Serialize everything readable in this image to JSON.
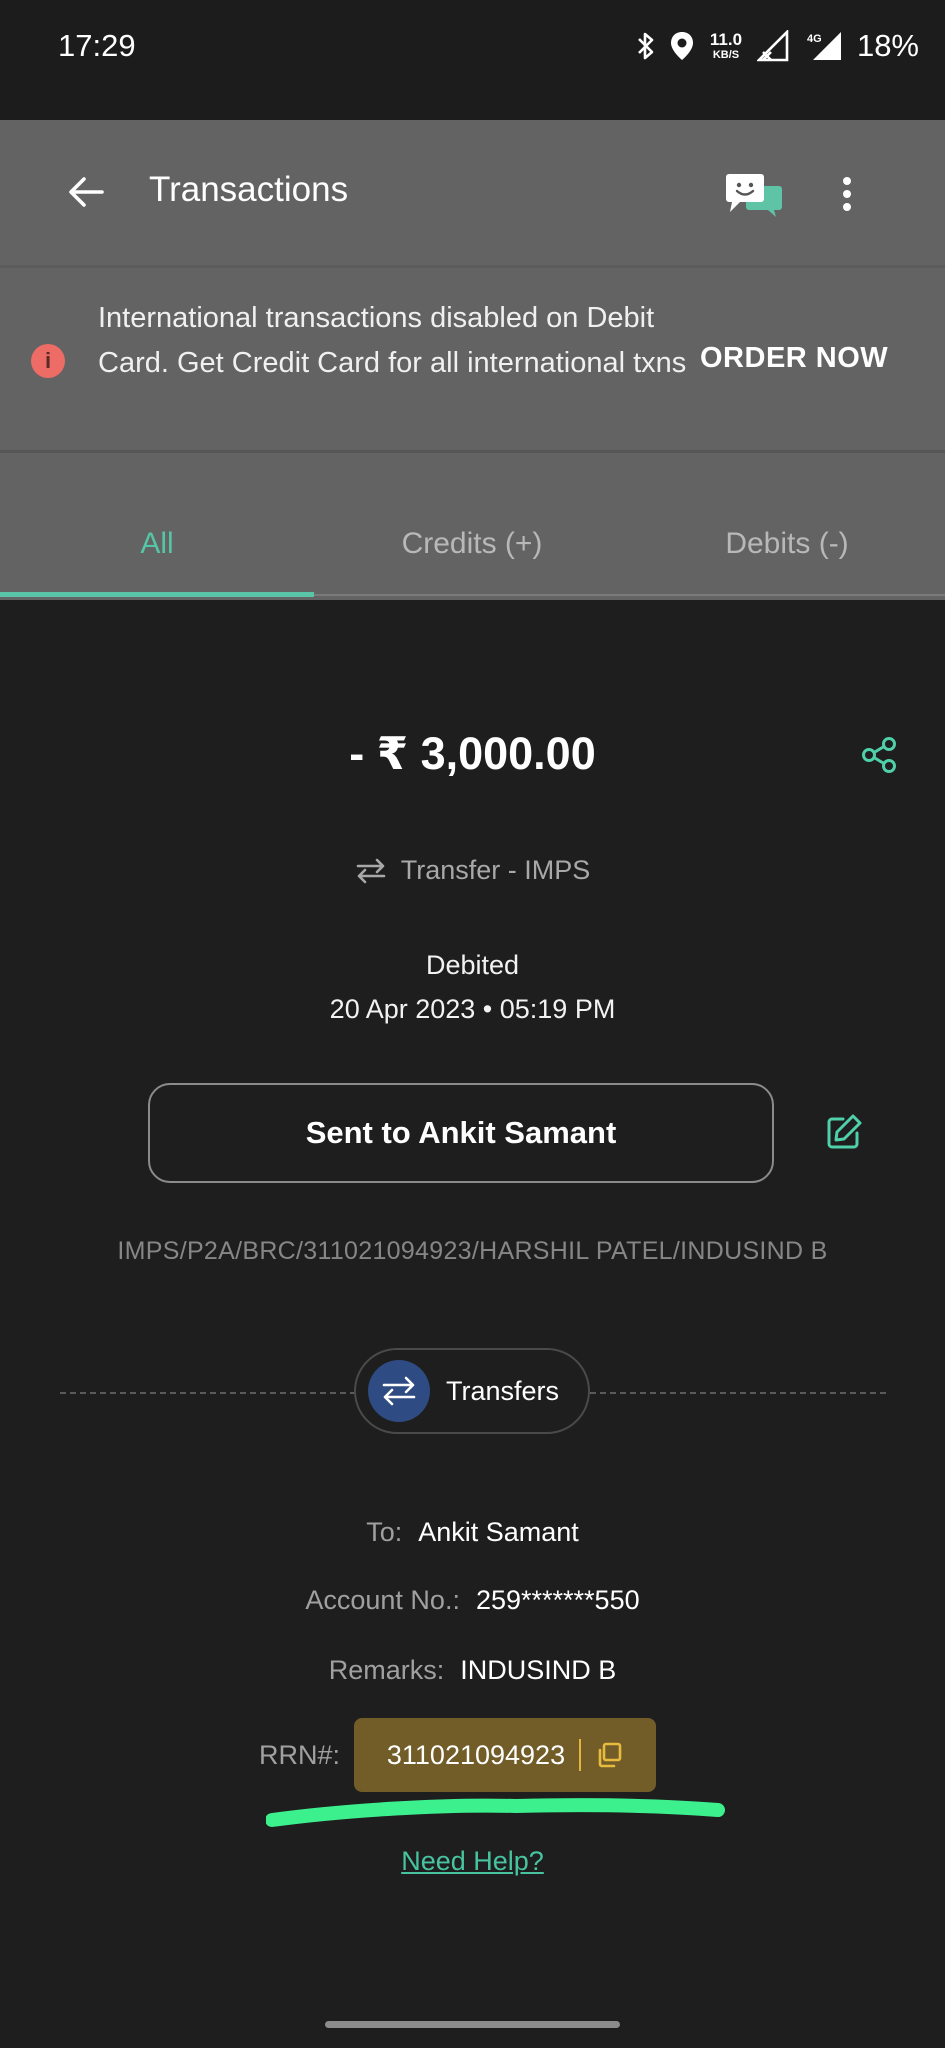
{
  "status_bar": {
    "time": "17:29",
    "net_speed_value": "11.0",
    "net_speed_unit": "KB/S",
    "network": "4G",
    "battery": "18%",
    "icons": [
      "bluetooth-icon",
      "location-icon",
      "signal-icon",
      "battery-icon"
    ]
  },
  "app_bar": {
    "title": "Transactions",
    "back_icon": "arrow-left-icon",
    "chat_icon": "chat-support-icon",
    "more_icon": "more-vert-icon"
  },
  "banner": {
    "text": "International transactions disabled on Debit Card. Get Credit Card for all international txns",
    "action": "ORDER NOW",
    "icon": "info-icon",
    "icon_glyph": "i"
  },
  "tabs": [
    {
      "label": "All",
      "selected": true
    },
    {
      "label": "Credits (+)",
      "selected": false
    },
    {
      "label": "Debits (-)",
      "selected": false
    }
  ],
  "transaction": {
    "amount": "- ₹ 3,000.00",
    "type": "Transfer - IMPS",
    "status": "Debited",
    "datetime": "20 Apr 2023 • 05:19 PM",
    "sent_to": "Sent to Ankit Samant",
    "narration": "IMPS/P2A/BRC/311021094923/HARSHIL PATEL/INDUSIND B",
    "category": "Transfers",
    "details": {
      "to_label": "To:",
      "to_value": "Ankit Samant",
      "account_label": "Account No.:",
      "account_value": "259*******550",
      "remarks_label": "Remarks:",
      "remarks_value": "INDUSIND B",
      "rrn_label": "RRN#:",
      "rrn_value": "311021094923"
    },
    "help_link": "Need Help?"
  },
  "colors": {
    "accent": "#55c5a5",
    "sheet_bg": "#1e1e1e",
    "overlay": "#636363",
    "rrn_bg": "#725d28",
    "highlight": "#3cf08e",
    "category_circle": "#2f4b83"
  }
}
